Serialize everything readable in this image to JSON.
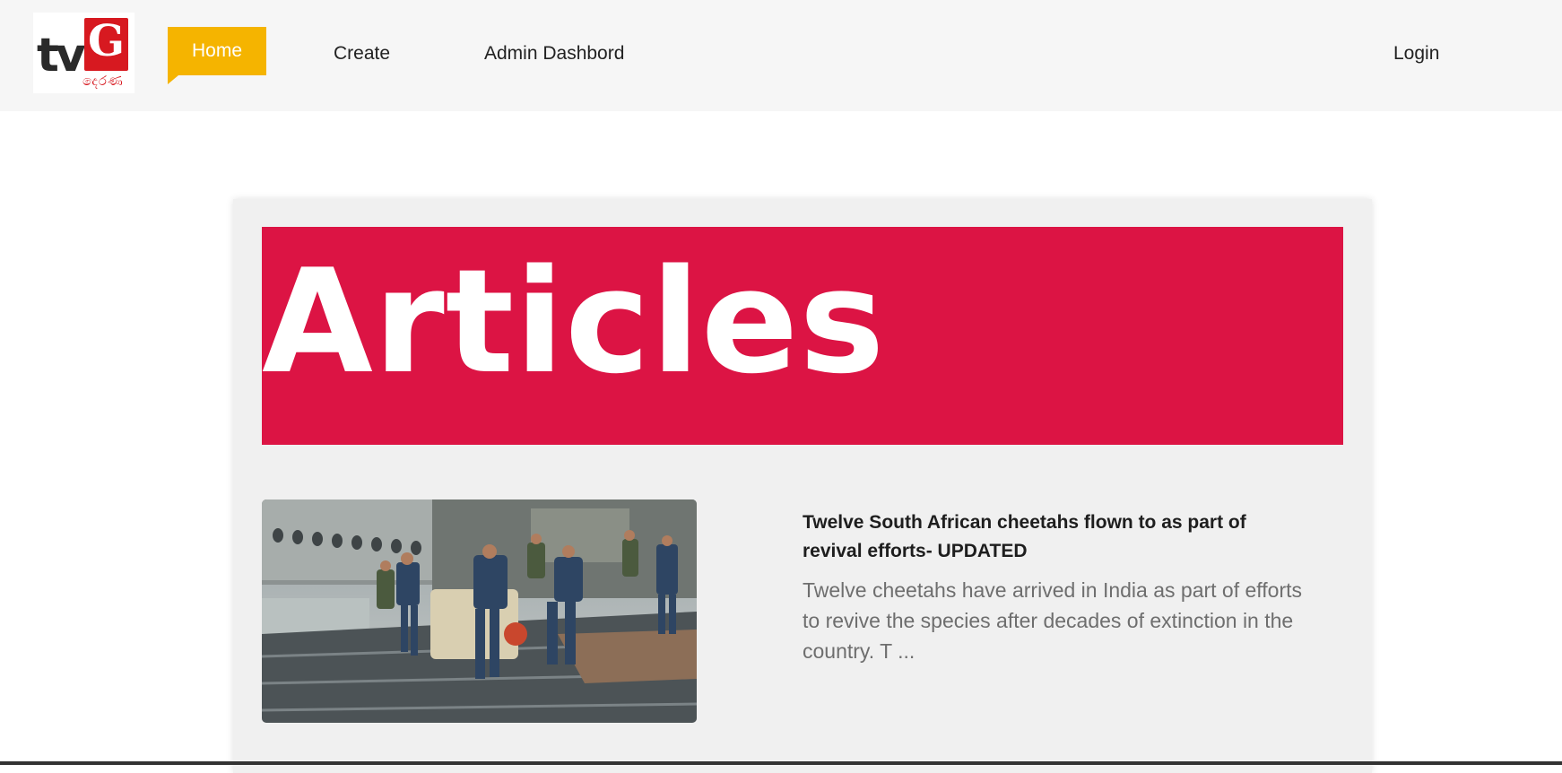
{
  "logo": {
    "tv": "tv",
    "g": "G",
    "script": "දෙරණ"
  },
  "nav": {
    "home": "Home",
    "create": "Create",
    "admin": "Admin Dashbord",
    "login": "Login"
  },
  "colors": {
    "accent": "#f5b400",
    "banner": "#dc1444",
    "logo_red": "#d71920"
  },
  "banner": {
    "title": "Articles"
  },
  "articles": [
    {
      "title": "Twelve South African cheetahs flown to as part of revival efforts- UPDATED",
      "excerpt": "Twelve cheetahs have arrived in India as part of efforts to revive the species after decades of extinction in the country. T ..."
    }
  ]
}
